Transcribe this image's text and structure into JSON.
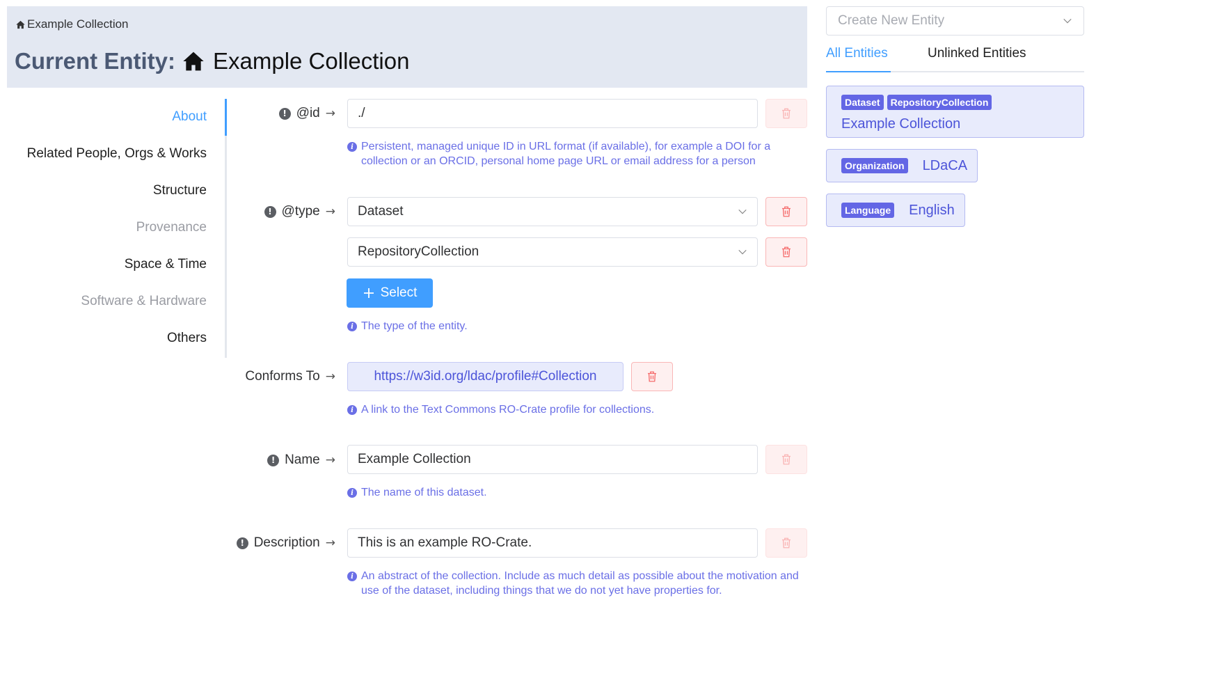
{
  "breadcrumb": {
    "icon": "home-icon",
    "label": "Example Collection"
  },
  "header": {
    "title_label": "Current Entity:",
    "entity_icon": "home-icon",
    "entity_name": "Example Collection"
  },
  "sidenav": {
    "items": [
      {
        "label": "About",
        "state": "active"
      },
      {
        "label": "Related People, Orgs & Works",
        "state": "normal"
      },
      {
        "label": "Structure",
        "state": "normal"
      },
      {
        "label": "Provenance",
        "state": "disabled"
      },
      {
        "label": "Space & Time",
        "state": "normal"
      },
      {
        "label": "Software & Hardware",
        "state": "disabled"
      },
      {
        "label": "Others",
        "state": "normal"
      }
    ]
  },
  "form": {
    "id": {
      "label": "@id",
      "value": "./",
      "help": "Persistent, managed unique ID in URL format (if available), for example a DOI for a collection or an ORCID, personal home page URL or email address for a person"
    },
    "type": {
      "label": "@type",
      "values": [
        "Dataset",
        "RepositoryCollection"
      ],
      "select_label": "Select",
      "help": "The type of the entity."
    },
    "conforms_to": {
      "label": "Conforms To",
      "value": "https://w3id.org/ldac/profile#Collection",
      "help": "A link to the Text Commons RO-Crate profile for collections."
    },
    "name": {
      "label": "Name",
      "value": "Example Collection",
      "help": "The name of this dataset."
    },
    "description": {
      "label": "Description",
      "value": "This is an example RO-Crate.",
      "help": "An abstract of the collection. Include as much detail as possible about the motivation and use of the dataset, including things that we do not yet have properties for."
    }
  },
  "right_panel": {
    "create_placeholder": "Create New Entity",
    "tabs": [
      {
        "label": "All Entities",
        "active": true
      },
      {
        "label": "Unlinked Entities",
        "active": false
      }
    ],
    "entities": [
      {
        "tags": [
          "Dataset",
          "RepositoryCollection"
        ],
        "name": "Example Collection"
      },
      {
        "tags": [
          "Organization"
        ],
        "name": "LDaCA"
      },
      {
        "tags": [
          "Language"
        ],
        "name": "English"
      }
    ]
  },
  "colors": {
    "accent": "#409eff",
    "link": "#4c54d9",
    "tag": "#6366e5",
    "danger": "#f56c6c",
    "header_bg": "#e3e8f2"
  }
}
